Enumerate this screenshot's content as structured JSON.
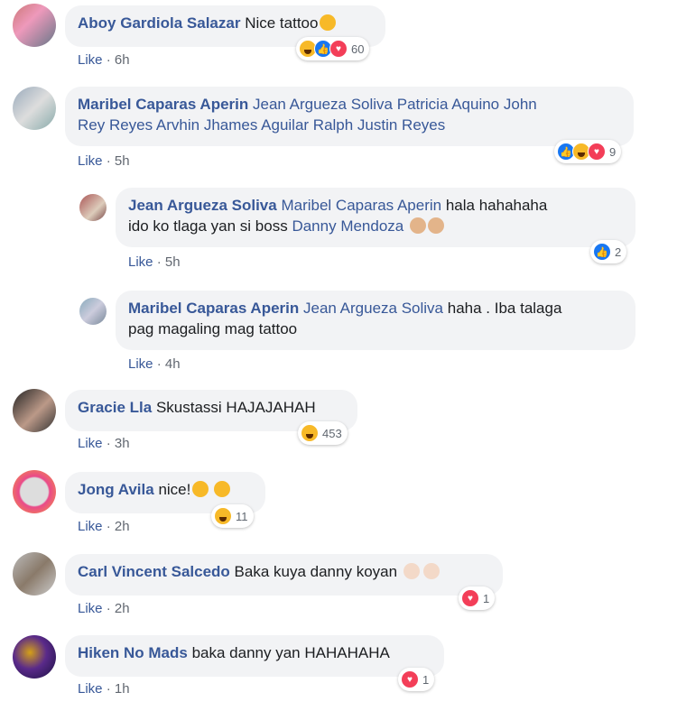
{
  "comments": [
    {
      "author": "Aboy Gardiola Salazar",
      "text": "Nice tattoo",
      "like": "Like",
      "time": "6h",
      "count": "60"
    },
    {
      "author": "Maribel Caparas Aperin",
      "tags": "Jean Argueza Soliva Patricia Aquino John",
      "tags2": "Rey Reyes Arvhin Jhames Aguilar Ralph Justin Reyes",
      "like": "Like",
      "time": "5h",
      "count": "9"
    },
    {
      "author": "Jean Argueza Soliva",
      "tag1": "Maribel Caparas Aperin",
      "text1": "hala hahahaha",
      "text2": "ido ko tlaga yan si boss",
      "tag2": "Danny Mendoza",
      "like": "Like",
      "time": "5h",
      "count": "2"
    },
    {
      "author": "Maribel Caparas Aperin",
      "tag1": "Jean Argueza Soliva",
      "text1": "haha . Iba talaga",
      "text2": "pag magaling mag tattoo",
      "like": "Like",
      "time": "4h"
    },
    {
      "author": "Gracie Lla",
      "text": "Skustassi HAJAJAHAH",
      "like": "Like",
      "time": "3h",
      "count": "453"
    },
    {
      "author": "Jong Avila",
      "text": "nice!",
      "like": "Like",
      "time": "2h",
      "count": "11"
    },
    {
      "author": "Carl Vincent Salcedo",
      "text": "Baka kuya danny koyan",
      "like": "Like",
      "time": "2h",
      "count": "1"
    },
    {
      "author": "Hiken No Mads",
      "text": "baka danny yan HAHAHAHA",
      "like": "Like",
      "time": "1h",
      "count": "1"
    }
  ],
  "sep": "·",
  "icons": {
    "haha": "haha-reaction-icon",
    "like": "like-reaction-icon",
    "love": "love-reaction-icon"
  },
  "colors": {
    "link": "#385898",
    "bubble": "#f2f3f5",
    "meta": "#616770"
  }
}
